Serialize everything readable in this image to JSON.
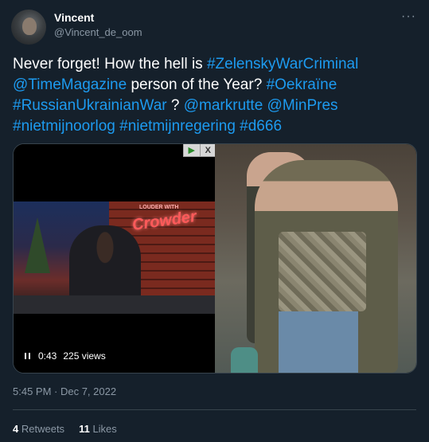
{
  "author": {
    "name": "Vincent",
    "handle": "@Vincent_de_oom"
  },
  "more_label": "···",
  "tweet": {
    "text_plain": "Never forget! How the hell is",
    "hashtag1": "#ZelenskyWarCriminal",
    "mention1": "@TimeMagazine",
    "text_mid": "person of the Year?",
    "hashtag2": "#Oekraïne",
    "hashtag3": "#RussianUkrainianWar",
    "text_q": "?",
    "mention2": "@markrutte",
    "mention3": "@MinPres",
    "hashtag4": "#nietmijnoorlog",
    "hashtag5": "#nietmijnregering",
    "hashtag6": "#d666"
  },
  "media": {
    "neon_small": "LOUDER WITH",
    "neon_sign": "Crowder",
    "ad_play_glyph": "▶",
    "ad_close_glyph": "X",
    "video_time": "0:43",
    "video_views": "225 views"
  },
  "timestamp": "5:45 PM · Dec 7, 2022",
  "stats": {
    "retweets_count": "4",
    "retweets_label": "Retweets",
    "likes_count": "11",
    "likes_label": "Likes"
  },
  "colors": {
    "background": "#15202b",
    "link": "#1d9bf0",
    "secondary_text": "#8b98a5"
  }
}
